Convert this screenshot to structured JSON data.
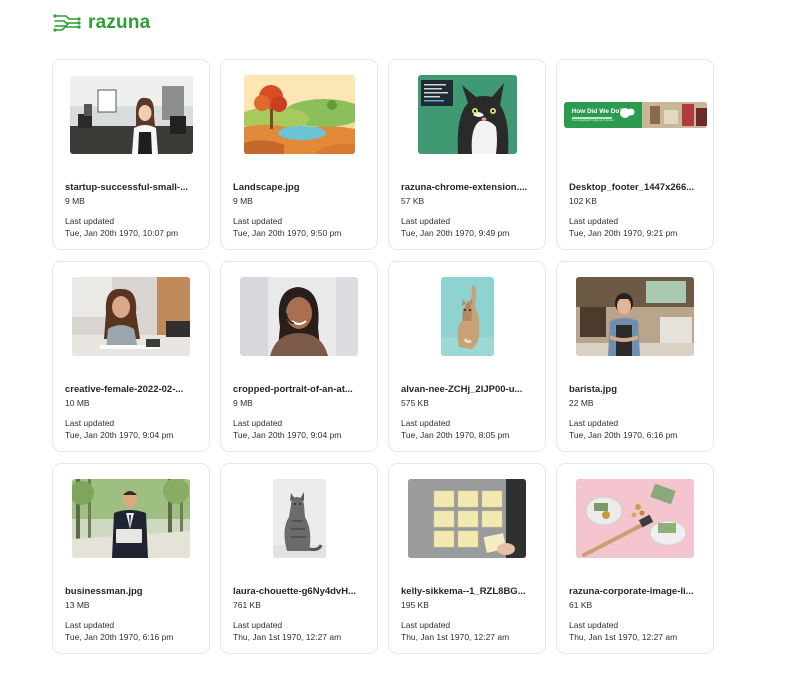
{
  "app": {
    "logo_text": "razuna",
    "brand_color": "#2f9e35"
  },
  "files": [
    {
      "name": "startup-successful-small-...",
      "size": "9 MB",
      "updated_label": "Last updated",
      "updated": "Tue, Jan 20th 1970, 10:07 pm",
      "thumb": "barista-counter"
    },
    {
      "name": "Landscape.jpg",
      "size": "9 MB",
      "updated_label": "Last updated",
      "updated": "Tue, Jan 20th 1970, 9:50 pm",
      "thumb": "landscape"
    },
    {
      "name": "razuna-chrome-extension....",
      "size": "57 KB",
      "updated_label": "Last updated",
      "updated": "Tue, Jan 20th 1970, 9:49 pm",
      "thumb": "cat-screen"
    },
    {
      "name": "Desktop_footer_1447x266...",
      "size": "102 KB",
      "updated_label": "Last updated",
      "updated": "Tue, Jan 20th 1970, 9:21 pm",
      "thumb": "banner",
      "banner_text": "How Did We Do?",
      "banner_sub": "Your feedback helps us improve"
    },
    {
      "name": "creative-female-2022-02-...",
      "size": "10 MB",
      "updated_label": "Last updated",
      "updated": "Tue, Jan 20th 1970, 9:04 pm",
      "thumb": "woman-desk"
    },
    {
      "name": "cropped-portrait-of-an-at...",
      "size": "9 MB",
      "updated_label": "Last updated",
      "updated": "Tue, Jan 20th 1970, 9:04 pm",
      "thumb": "headset-woman"
    },
    {
      "name": "alvan-nee-ZCHj_2lJP00-u...",
      "size": "575 KB",
      "updated_label": "Last updated",
      "updated": "Tue, Jan 20th 1970, 8:05 pm",
      "thumb": "kitten-teal"
    },
    {
      "name": "barista.jpg",
      "size": "22 MB",
      "updated_label": "Last updated",
      "updated": "Tue, Jan 20th 1970, 6:16 pm",
      "thumb": "barista-cafe"
    },
    {
      "name": "businessman.jpg",
      "size": "13 MB",
      "updated_label": "Last updated",
      "updated": "Tue, Jan 20th 1970, 6:16 pm",
      "thumb": "businessman"
    },
    {
      "name": "laura-chouette-g6Ny4dvH...",
      "size": "761 KB",
      "updated_label": "Last updated",
      "updated": "Thu, Jan 1st 1970, 12:27 am",
      "thumb": "cat-gray"
    },
    {
      "name": "kelly-sikkema--1_RZL8BG...",
      "size": "195 KB",
      "updated_label": "Last updated",
      "updated": "Thu, Jan 1st 1970, 12:27 am",
      "thumb": "sticky-notes"
    },
    {
      "name": "razuna-corporate-image-li...",
      "size": "61 KB",
      "updated_label": "Last updated",
      "updated": "Thu, Jan 1st 1970, 12:27 am",
      "thumb": "money-pink"
    }
  ]
}
